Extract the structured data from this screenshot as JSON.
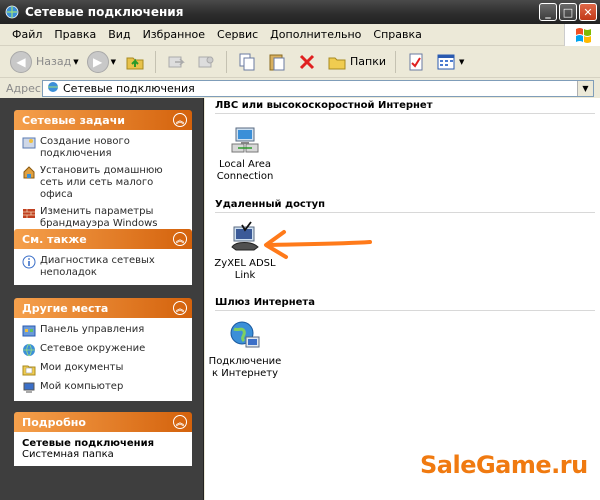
{
  "window": {
    "title": "Сетевые подключения"
  },
  "menu": [
    "Файл",
    "Правка",
    "Вид",
    "Избранное",
    "Сервис",
    "Дополнительно",
    "Справка"
  ],
  "toolbar": {
    "back_label": "Назад",
    "folders_label": "Папки"
  },
  "address": {
    "label": "Адрес:",
    "value": "Сетевые подключения"
  },
  "tasks": {
    "network": {
      "title": "Сетевые задачи",
      "items": [
        "Создание нового подключения",
        "Установить домашнюю сеть или сеть малого офиса",
        "Изменить параметры брандмауэра Windows"
      ]
    },
    "see_also": {
      "title": "См. также",
      "items": [
        "Диагностика сетевых неполадок"
      ]
    },
    "other_places": {
      "title": "Другие места",
      "items": [
        "Панель управления",
        "Сетевое окружение",
        "Мои документы",
        "Мой компьютер"
      ]
    },
    "details": {
      "title": "Подробно",
      "name": "Сетевые подключения",
      "type": "Системная папка"
    }
  },
  "groups": {
    "lan": {
      "title": "ЛВС или высокоскоростной Интернет",
      "item": "Local Area Connection"
    },
    "dialup": {
      "title": "Удаленный доступ",
      "item": "ZyXEL ADSL Link"
    },
    "gateway": {
      "title": "Шлюз Интернета",
      "item": "Подключение к Интернету"
    }
  },
  "watermark": "SaleGame.ru"
}
